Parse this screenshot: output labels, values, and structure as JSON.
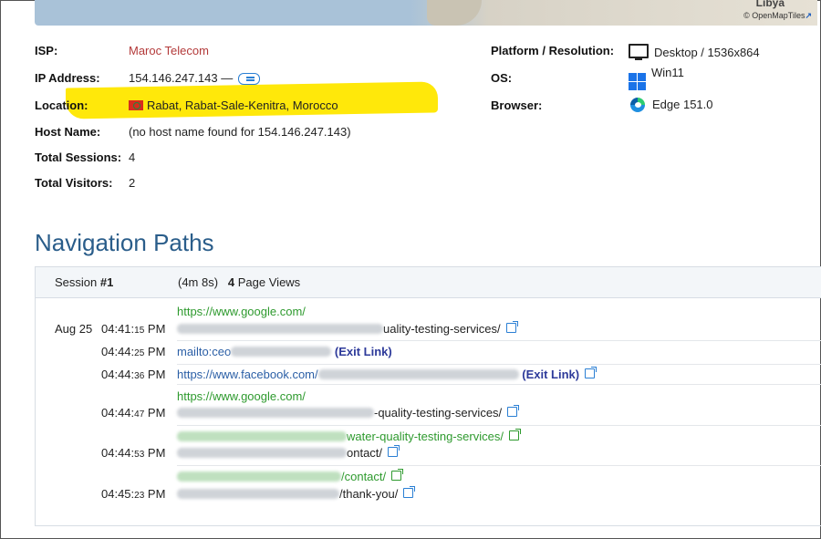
{
  "map": {
    "city_label": "Libya",
    "credit": "© OpenMapTiles"
  },
  "info": {
    "isp_label": "ISP:",
    "isp_value": "Maroc Telecom",
    "ip_label": "IP Address:",
    "ip_value": "154.146.247.143 —",
    "location_label": "Location:",
    "location_value": "Rabat, Rabat-Sale-Kenitra, Morocco",
    "host_label": "Host Name:",
    "host_value": "(no host name found for 154.146.247.143)",
    "sessions_label": "Total Sessions:",
    "sessions_value": "4",
    "visitors_label": "Total Visitors:",
    "visitors_value": "2",
    "platform_label": "Platform / Resolution:",
    "platform_value": "Desktop / 1536x864",
    "os_label": "OS:",
    "os_value": "Win11",
    "browser_label": "Browser:",
    "browser_value": "Edge 151.0"
  },
  "nav": {
    "title": "Navigation Paths",
    "session_label": "Session",
    "session_number": "#1",
    "duration": "(4m 8s)",
    "page_views_count": "4",
    "page_views_label": "Page Views",
    "date": "Aug 25",
    "rows": [
      {
        "referrer": "https://www.google.com/",
        "time_hm": "04:41:",
        "time_s": "15",
        "ampm": "PM",
        "page_tail": "uality-testing-services/"
      },
      {
        "time_hm": "04:44:",
        "time_s": "25",
        "ampm": "PM",
        "link_prefix": "mailto:ceo",
        "exit_label": "(Exit Link)"
      },
      {
        "time_hm": "04:44:",
        "time_s": "36",
        "ampm": "PM",
        "link_prefix": "https://www.facebook.com/",
        "exit_label": "(Exit Link)"
      },
      {
        "referrer": "https://www.google.com/",
        "time_hm": "04:44:",
        "time_s": "47",
        "ampm": "PM",
        "page_tail": "-quality-testing-services/"
      },
      {
        "referrer_tail": "water-quality-testing-services/",
        "time_hm": "04:44:",
        "time_s": "53",
        "ampm": "PM",
        "page_tail": "ontact/"
      },
      {
        "referrer_tail": "/contact/",
        "time_hm": "04:45:",
        "time_s": "23",
        "ampm": "PM",
        "page_tail": "/thank-you/"
      }
    ]
  },
  "colors": {
    "isp": "#b33a3a",
    "title": "#2a5d8a",
    "referrer": "#2e9a2e",
    "exit": "#2d3a9a",
    "highlight": "#ffe80a"
  }
}
